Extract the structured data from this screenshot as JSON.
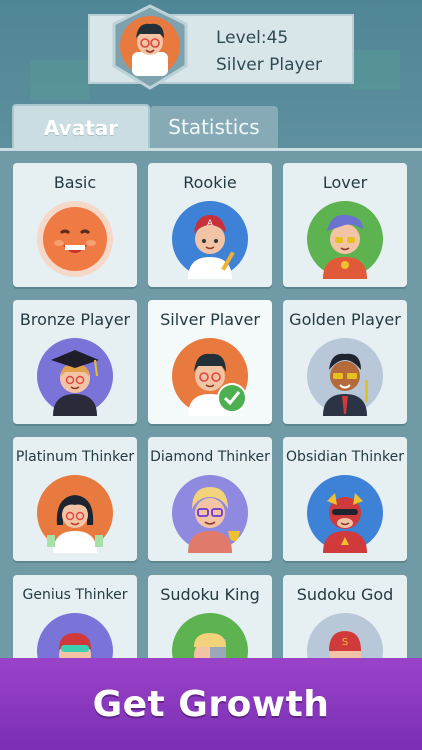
{
  "profile": {
    "level_text": "Level:45",
    "rank_text": "Silver Player"
  },
  "tabs": [
    {
      "label": "Avatar",
      "active": true
    },
    {
      "label": "Statistics",
      "active": false
    }
  ],
  "avatars": [
    {
      "label": "Basic",
      "icon": "smiley-avatar-icon"
    },
    {
      "label": "Rookie",
      "icon": "rookie-boy-avatar-icon"
    },
    {
      "label": "Lover",
      "icon": "lover-boy-avatar-icon"
    },
    {
      "label": "Bronze Player",
      "icon": "graduate-avatar-icon"
    },
    {
      "label": "Silver Plaver",
      "icon": "silver-boy-avatar-icon",
      "selected": true
    },
    {
      "label": "Golden Player",
      "icon": "golden-man-avatar-icon"
    },
    {
      "label": "Platinum Thinker",
      "icon": "platinum-girl-avatar-icon"
    },
    {
      "label": "Diamond Thinker",
      "icon": "diamond-blonde-avatar-icon"
    },
    {
      "label": "Obsidian Thinker",
      "icon": "obsidian-hero-avatar-icon"
    },
    {
      "label": "Genius Thinker",
      "icon": "genius-visor-avatar-icon"
    },
    {
      "label": "Sudoku King",
      "icon": "sudoku-king-robot-avatar-icon"
    },
    {
      "label": "Sudoku God",
      "icon": "sudoku-god-hero-avatar-icon"
    }
  ],
  "banner": {
    "headline": "Get Growth"
  },
  "colors": {
    "accent_purple": "#8a39c0",
    "panel": "#6f9aa6",
    "card": "#e6f0f3"
  }
}
